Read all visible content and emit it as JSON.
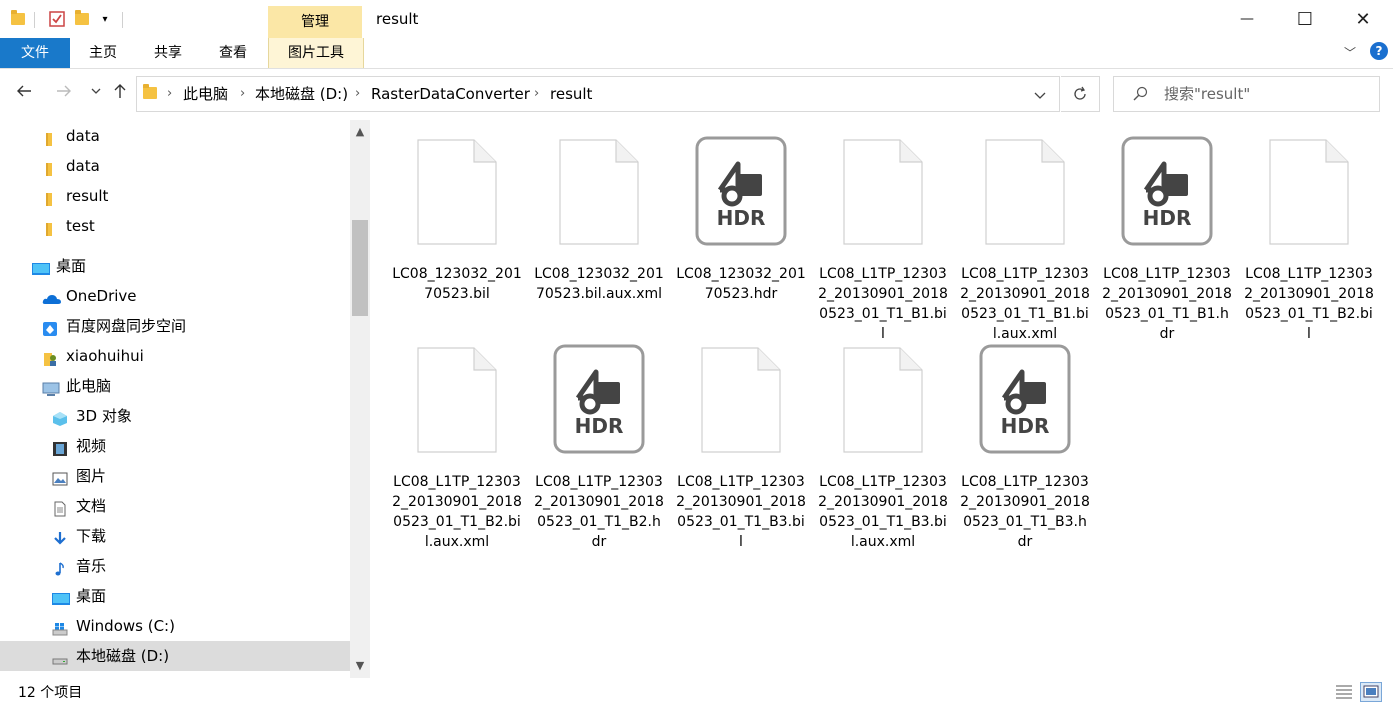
{
  "window": {
    "title": "result",
    "manage_tab": "管理",
    "min_symbol": "—",
    "max_symbol": "☐",
    "close_symbol": "✕"
  },
  "ribbon": {
    "tabs": [
      "文件",
      "主页",
      "共享",
      "查看",
      "图片工具"
    ],
    "help": "?"
  },
  "address": {
    "crumbs": [
      "此电脑",
      "本地磁盘 (D:)",
      "RasterDataConverter",
      "result"
    ]
  },
  "search": {
    "placeholder": "搜索\"result\""
  },
  "sidebar": {
    "items": [
      {
        "label": "data",
        "icon": "folder-icon"
      },
      {
        "label": "data",
        "icon": "folder-icon"
      },
      {
        "label": "result",
        "icon": "folder-icon"
      },
      {
        "label": "test",
        "icon": "folder-icon"
      },
      {
        "label": "桌面",
        "icon": "desktop-icon"
      },
      {
        "label": "OneDrive",
        "icon": "cloud-icon"
      },
      {
        "label": "百度网盘同步空间",
        "icon": "baidu-netdisk-icon"
      },
      {
        "label": "xiaohuihui",
        "icon": "user-icon"
      },
      {
        "label": "此电脑",
        "icon": "pc-icon"
      },
      {
        "label": "3D 对象",
        "icon": "3d-objects-icon"
      },
      {
        "label": "视频",
        "icon": "video-icon"
      },
      {
        "label": "图片",
        "icon": "pictures-icon"
      },
      {
        "label": "文档",
        "icon": "documents-icon"
      },
      {
        "label": "下载",
        "icon": "download-icon"
      },
      {
        "label": "音乐",
        "icon": "music-icon"
      },
      {
        "label": "桌面",
        "icon": "desktop-icon"
      },
      {
        "label": "Windows (C:)",
        "icon": "windows-drive-icon"
      },
      {
        "label": "本地磁盘 (D:)",
        "icon": "drive-icon"
      }
    ]
  },
  "files": [
    {
      "name": "LC08_123032_20170523.bil",
      "type": "blank"
    },
    {
      "name": "LC08_123032_20170523.bil.aux.xml",
      "type": "blank"
    },
    {
      "name": "LC08_123032_20170523.hdr",
      "type": "hdr"
    },
    {
      "name": "LC08_L1TP_123032_20130901_20180523_01_T1_B1.bil",
      "type": "blank"
    },
    {
      "name": "LC08_L1TP_123032_20130901_20180523_01_T1_B1.bil.aux.xml",
      "type": "blank"
    },
    {
      "name": "LC08_L1TP_123032_20130901_20180523_01_T1_B1.hdr",
      "type": "hdr"
    },
    {
      "name": "LC08_L1TP_123032_20130901_20180523_01_T1_B2.bil",
      "type": "blank"
    },
    {
      "name": "LC08_L1TP_123032_20130901_20180523_01_T1_B2.bil.aux.xml",
      "type": "blank"
    },
    {
      "name": "LC08_L1TP_123032_20130901_20180523_01_T1_B2.hdr",
      "type": "hdr"
    },
    {
      "name": "LC08_L1TP_123032_20130901_20180523_01_T1_B3.bil",
      "type": "blank"
    },
    {
      "name": "LC08_L1TP_123032_20130901_20180523_01_T1_B3.bil.aux.xml",
      "type": "blank"
    },
    {
      "name": "LC08_L1TP_123032_20130901_20180523_01_T1_B3.hdr",
      "type": "hdr"
    }
  ],
  "hdr_label": "HDR",
  "status": {
    "count": "12 个项目"
  },
  "colors": {
    "accent": "#1979ca",
    "manage_tab": "#fbe7a6",
    "folder": "#f5c242"
  }
}
